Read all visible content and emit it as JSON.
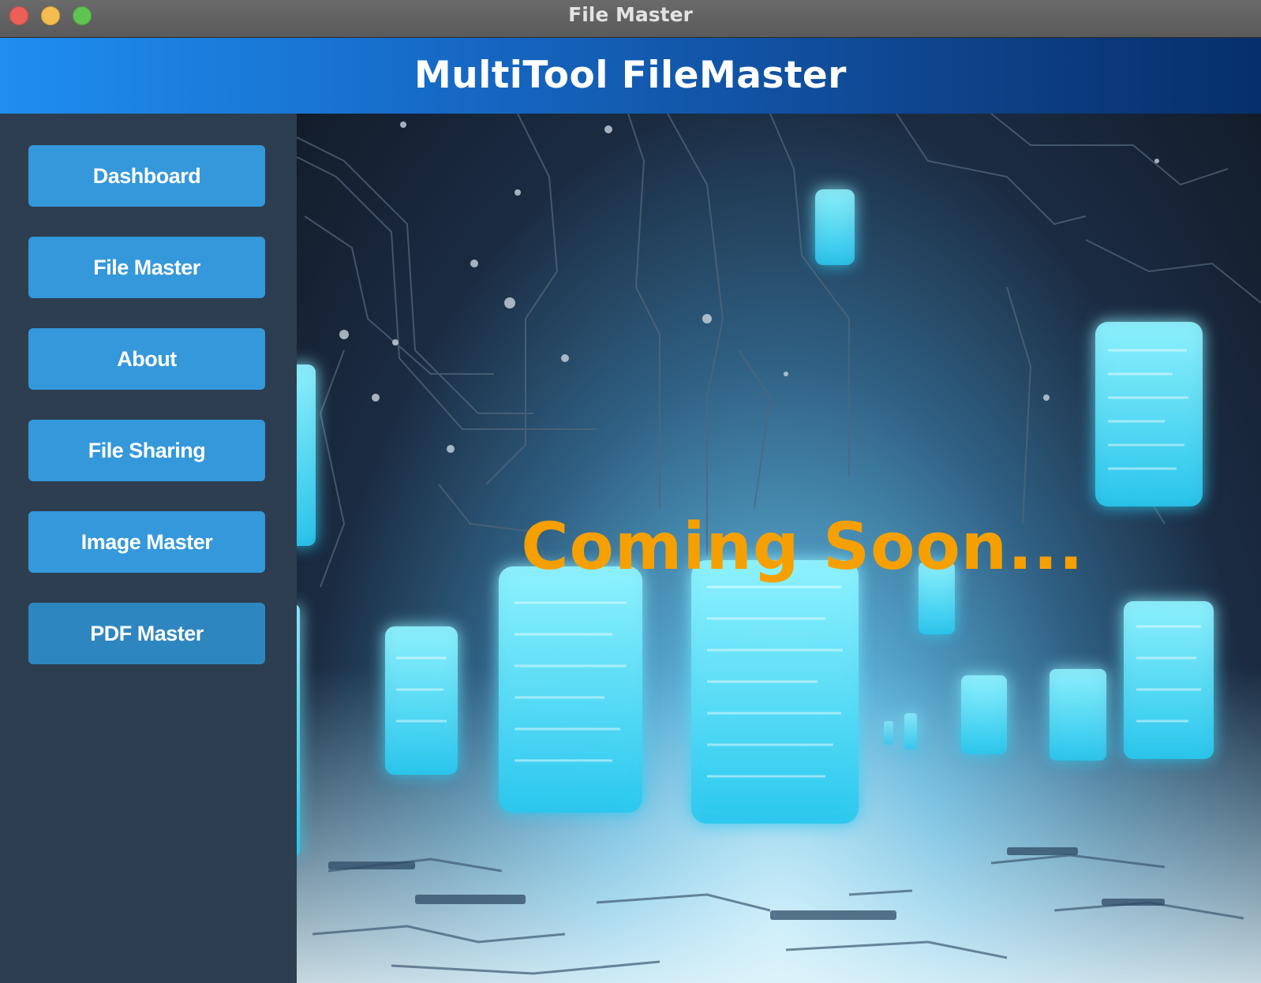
{
  "window": {
    "title": "File Master",
    "controls": [
      "close",
      "minimize",
      "maximize"
    ]
  },
  "header": {
    "title": "MultiTool FileMaster"
  },
  "sidebar": {
    "items": [
      {
        "label": "Dashboard"
      },
      {
        "label": "File Master"
      },
      {
        "label": "About"
      },
      {
        "label": "File Sharing"
      },
      {
        "label": "Image Master"
      },
      {
        "label": "PDF Master"
      }
    ],
    "active_item": "PDF Master"
  },
  "main": {
    "message": "Coming Soon...",
    "background_image": "glowing-files-circuit-artwork"
  },
  "colors": {
    "sidebar_bg": "#2c3e50",
    "button_bg": "#3498db",
    "button_active_bg": "#2e86c1",
    "header_gradient_start": "#1f8ef1",
    "header_gradient_end": "#062f6c",
    "message_color": "#f5a000"
  }
}
